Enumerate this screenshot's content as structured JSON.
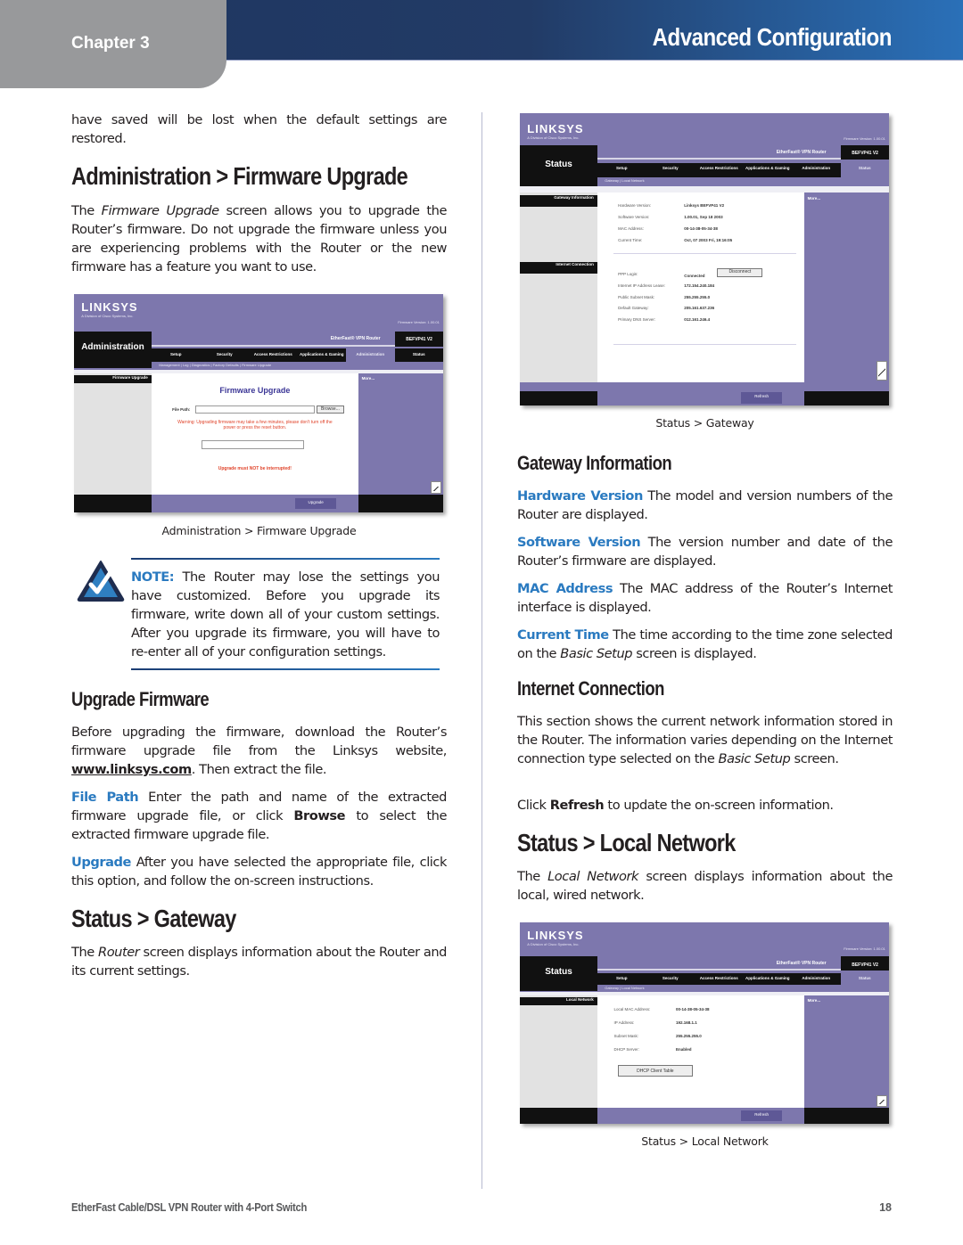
{
  "header": {
    "chapter": "Chapter 3",
    "section": "Advanced Configuration"
  },
  "left": {
    "intro_continued": "have saved will be lost when the default settings are restored.",
    "fw_heading": "Administration > Firmware Upgrade",
    "fw_intro": {
      "pre": "The ",
      "italic": "Firmware Upgrade",
      "post": " screen allows you to upgrade the Router’s firmware. Do not upgrade the firmware unless you are experiencing problems with the Router or the new firmware has a feature you want to use."
    },
    "fw_caption": "Administration > Firmware Upgrade",
    "note": {
      "label": "NOTE:",
      "text": " The Router may lose the settings you have customized. Before you upgrade its firmware, write down all of your custom settings. After you upgrade its firmware, you will have to re-enter all of your configuration settings."
    },
    "upgrade_heading": "Upgrade Firmware",
    "upgrade_intro": {
      "pre": "Before upgrading the firmware, download the Router’s firmware upgrade file from the Linksys website, ",
      "link": "www.linksys.com",
      "post": ". Then extract the file."
    },
    "file_path": {
      "term": "File Path",
      "pre": " Enter the path and name of the extracted firmware upgrade file, or click ",
      "bold": "Browse",
      "post": " to select the extracted firmware upgrade file."
    },
    "upgrade": {
      "term": "Upgrade",
      "text": " After you have selected the appropriate file, click this option, and follow the on-screen instructions."
    },
    "gateway_heading": "Status > Gateway",
    "gateway_intro": {
      "pre": "The ",
      "italic": "Router",
      "post": " screen displays information about the Router and its current settings."
    }
  },
  "right": {
    "gateway_caption": "Status > Gateway",
    "gwinfo_heading": "Gateway Information",
    "hardware": {
      "term": "Hardware Version",
      "text": "  The model and version numbers of the Router are displayed."
    },
    "software": {
      "term": "Software Version",
      "text": "  The version number and date of the Router’s firmware are displayed."
    },
    "mac": {
      "term": "MAC Address",
      "text": "  The MAC address of the Router’s Internet interface is displayed."
    },
    "time": {
      "term": "Current Time",
      "pre": "  The time according to the time zone selected on the ",
      "italic": "Basic Setup",
      "post": " screen is displayed."
    },
    "inet_heading": "Internet Connection",
    "inet_text": {
      "pre": "This section shows the current network information stored in the Router. The information varies depending on the Internet connection type selected on the ",
      "italic": "Basic Setup",
      "post": " screen."
    },
    "refresh_text": {
      "pre": "Click ",
      "bold": "Refresh",
      "post": " to update the on-screen information."
    },
    "local_heading": "Status > Local Network",
    "local_intro": {
      "pre": "The ",
      "italic": "Local Network",
      "post": " screen displays information about the local, wired network."
    },
    "local_caption": "Status > Local Network"
  },
  "screens": {
    "common": {
      "logo": "LINKSYS",
      "logo_sub": "A Division of Cisco Systems, Inc.",
      "firmware_version": "Firmware Version: 1.00.01",
      "product": "EtherFast® VPN Router",
      "model": "BEFVP41 V2",
      "tabs": [
        "Setup",
        "Security",
        "Access Restrictions",
        "Applications & Gaming",
        "Administration",
        "Status"
      ],
      "more": "More..."
    },
    "firmware": {
      "page": "Administration",
      "subtabs": "Management  |  Log  |  Diagnostics  |  Factory Defaults  |  Firmware Upgrade",
      "side": "Firmware Upgrade",
      "title": "Firmware Upgrade",
      "file_path_label": "File Path:",
      "browse": "Browse...",
      "warning": "Warning: Upgrading firmware may take a few minutes, please don't turn off the power or press the reset button.",
      "interrupt": "Upgrade must NOT be interrupted!",
      "action": "Upgrade"
    },
    "gateway": {
      "page": "Status",
      "subtabs": "Gateway  |  Local Network",
      "side1": "Gateway Information",
      "side2": "Internet Connection",
      "rows1": [
        [
          "Hardware Version:",
          "Linksys BEFVP41 V2"
        ],
        [
          "Software Version:",
          "1.00.01, Sep 18 2003"
        ],
        [
          "MAC Address:",
          "00-14-38-05-34-38"
        ],
        [
          "Current Time:",
          "Oct, 07 2003 Fri, 19:16:05"
        ]
      ],
      "ppp_label": "PPP Login:",
      "ppp_value": "Connected",
      "disconnect": "Disconnect",
      "rows2": [
        [
          "Internet IP Address Lease:",
          "172.154.240.184"
        ],
        [
          "Public Subnet Mask:",
          "255.255.255.0"
        ],
        [
          "Default Gateway:",
          "205.161.637.236"
        ],
        [
          "Primary DNS Server:",
          "012.161.246.4"
        ]
      ],
      "action": "Refresh"
    },
    "local": {
      "page": "Status",
      "subtabs": "Gateway  |  Local Network",
      "side": "Local Network",
      "rows": [
        [
          "Local MAC Address:",
          "00-14-38-05-34-38"
        ],
        [
          "IP Address:",
          "192.168.1.1"
        ],
        [
          "Subnet Mask:",
          "255.255.255.0"
        ],
        [
          "DHCP Server:",
          "Enabled"
        ]
      ],
      "dhcp_button": "DHCP Client Table",
      "action": "Refresh"
    }
  },
  "footer": {
    "title": "EtherFast Cable/DSL VPN Router with 4-Port Switch",
    "page": "18"
  },
  "colors": {
    "header_dark": "#1e3560",
    "header_light": "#2a70b8",
    "chapter_tab": "#98999b",
    "term_blue": "#2a7ac0",
    "linksys_purple": "#7d77ad"
  }
}
